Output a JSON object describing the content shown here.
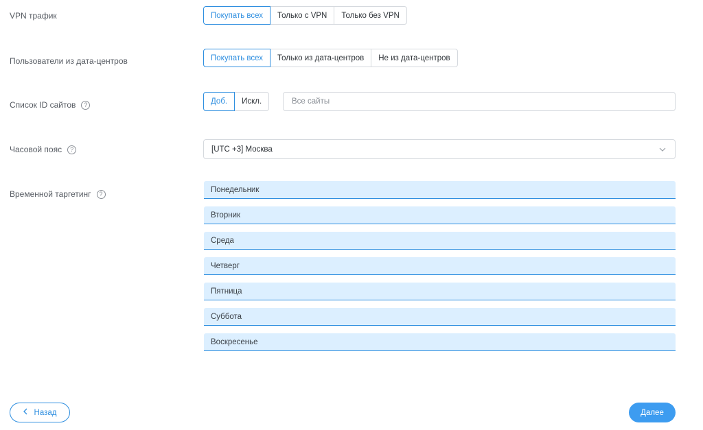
{
  "vpn": {
    "label": "VPN трафик",
    "options": [
      "Покупать всех",
      "Только с VPN",
      "Только без VPN"
    ]
  },
  "datacenter": {
    "label": "Пользователи из дата-центров",
    "options": [
      "Покупать всех",
      "Только из дата-центров",
      "Не из дата-центров"
    ]
  },
  "sites": {
    "label": "Список ID сайтов",
    "options": [
      "Доб.",
      "Искл."
    ],
    "placeholder": "Все сайты"
  },
  "timezone": {
    "label": "Часовой пояс",
    "value": "[UTC +3] Москва"
  },
  "time_targeting": {
    "label": "Временной таргетинг",
    "days": [
      "Понедельник",
      "Вторник",
      "Среда",
      "Четверг",
      "Пятница",
      "Суббота",
      "Воскресенье"
    ]
  },
  "footer": {
    "back_label": "Назад",
    "next_label": "Далее"
  },
  "colors": {
    "accent": "#2f8fe0",
    "day_bg": "#dcefff"
  }
}
